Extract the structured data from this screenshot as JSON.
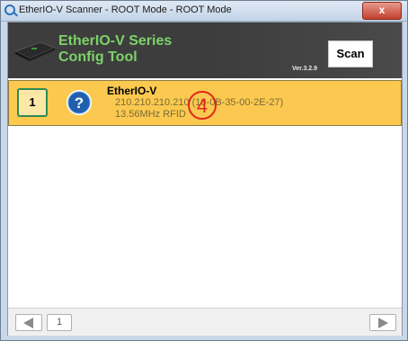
{
  "window": {
    "title": "EtherIO-V Scanner - ROOT Mode - ROOT Mode",
    "close_label": "x"
  },
  "header": {
    "title_line1": "EtherIO-V Series",
    "title_line2": "Config Tool",
    "version": "Ver.3.2.9",
    "scan_label": "Scan",
    "title_color": "#7dd26a"
  },
  "devices": [
    {
      "index": "1",
      "name": "EtherIO-V",
      "ip": "210.210.210.210 (10-0B-35-00-2E-27)",
      "type": "13.56MHz RFID",
      "status_icon": "question-icon",
      "marker": "④",
      "highlight_color": "#fbc94f"
    }
  ],
  "pager": {
    "prev_icon": "triangle-left-icon",
    "page": "1",
    "next_icon": "triangle-right-icon"
  }
}
